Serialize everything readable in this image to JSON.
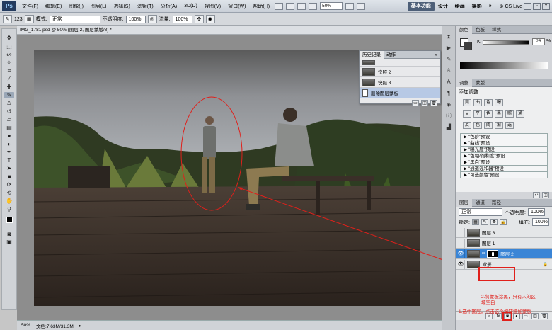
{
  "menu": {
    "items": [
      "文件(F)",
      "编辑(E)",
      "图像(I)",
      "图层(L)",
      "选择(S)",
      "滤镜(T)",
      "分析(A)",
      "3D(D)",
      "视图(V)",
      "窗口(W)",
      "帮助(H)"
    ],
    "zoom": "50%",
    "workspaces": [
      "基本功能",
      "设计",
      "绘画",
      "摄影"
    ],
    "cslive": "CS Live"
  },
  "options": {
    "brush_size": "123",
    "mode_label": "模式:",
    "mode_value": "正常",
    "opacity_label": "不透明度:",
    "opacity_value": "100%",
    "flow_label": "流量:",
    "flow_value": "100%"
  },
  "doc": {
    "tab_title": "IMG_1781.psd @ 50% (图层 2, 图层蒙版/8) *"
  },
  "status": {
    "zoom": "50%",
    "docinfo": "文档:7.63M/31.3M"
  },
  "history": {
    "tabs": [
      "历史记录",
      "动作"
    ],
    "rows": [
      "快照 2",
      "快照 3",
      "删除图层蒙板"
    ]
  },
  "color_panel": {
    "tabs": [
      "颜色",
      "色板",
      "样式"
    ],
    "k_label": "K",
    "k_value": "28",
    "k_unit": "%"
  },
  "adjust_panel": {
    "tabs": [
      "调整",
      "蒙版"
    ],
    "title": "添加调整",
    "icons_row1": [
      "亮",
      "曲",
      "色",
      "曝"
    ],
    "icons_row2": [
      "V",
      "平",
      "色",
      "黑",
      "照",
      "通"
    ],
    "icons_row3": [
      "反",
      "色",
      "阈",
      "渐",
      "选"
    ],
    "presets": [
      "\"色阶\"预设",
      "\"曲线\"预设",
      "\"曝光度\"预设",
      "\"色相/饱和度\"预设",
      "\"黑白\"预设",
      "\"通道混和器\"预设",
      "\"可选颜色\"预设"
    ]
  },
  "layers_panel": {
    "tabs": [
      "图层",
      "通道",
      "路径"
    ],
    "blend_mode": "正常",
    "opacity_label": "不透明度:",
    "opacity_value": "100%",
    "lock_label": "锁定:",
    "fill_label": "填充:",
    "fill_value": "100%",
    "layers": [
      {
        "name": "图层 3",
        "visible": false,
        "selected": false
      },
      {
        "name": "图层 1",
        "visible": false,
        "selected": false
      },
      {
        "name": "图层 2",
        "visible": true,
        "selected": true,
        "mask": true
      },
      {
        "name": "背景",
        "visible": true,
        "selected": false,
        "locked": true
      }
    ]
  },
  "annotations": {
    "note2_line1": "2.将蒙板涂黑，只有人的区",
    "note2_line2": "域空白",
    "note1": "1.选中图层，点击这个按钮增加蒙版"
  },
  "colors": {
    "annotation_red": "#e0201b",
    "selected_layer": "#3a85d6",
    "workspace_active": "#4d5f78"
  }
}
